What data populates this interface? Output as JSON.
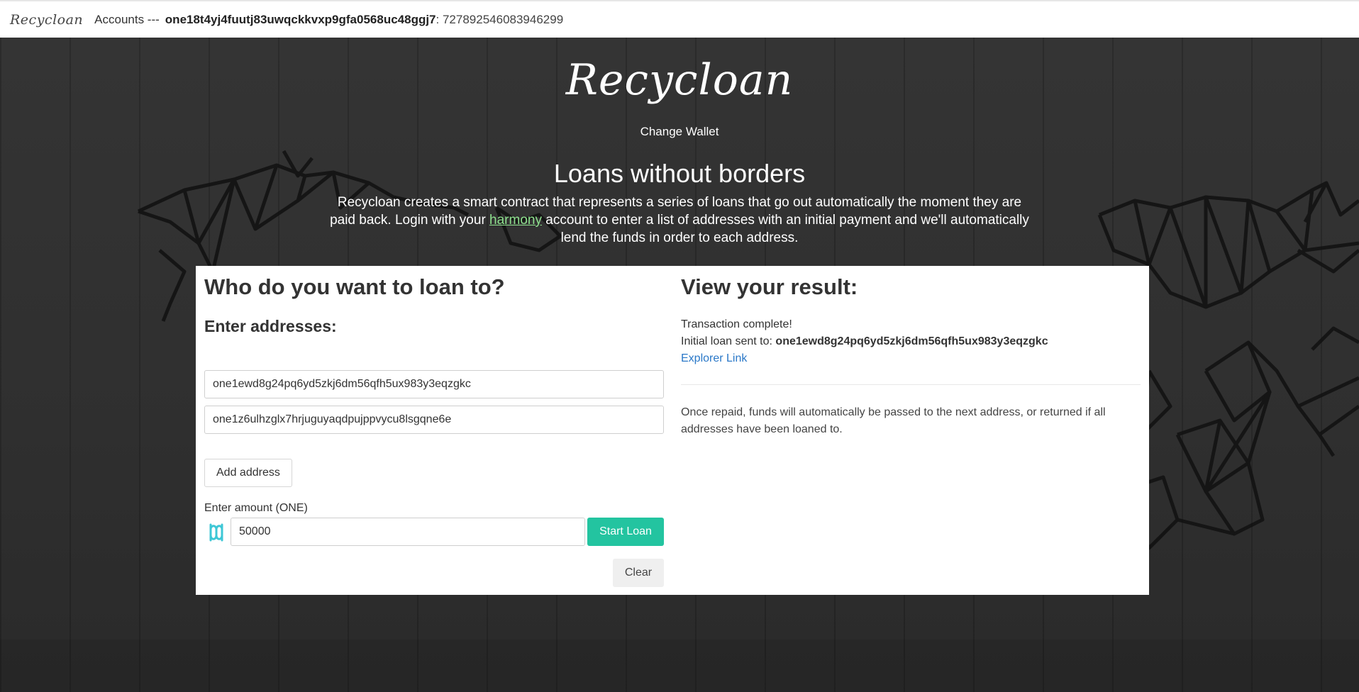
{
  "nav": {
    "logo": "Recycloan",
    "accounts_label": "Accounts ---",
    "address": "one18t4yj4fuutj83uwqckkvxp9gfa0568uc48ggj7",
    "balance": ": 727892546083946299"
  },
  "hero": {
    "brand": "Recycloan",
    "change_wallet": "Change Wallet",
    "headline": "Loans without borders",
    "intro_before": "Recycloan creates a smart contract that represents a series of loans that go out automatically the moment they are paid back. Login with your ",
    "intro_link": "harmony",
    "intro_after": " account to enter a list of addresses with an initial payment and we'll automatically lend the funds in order to each address."
  },
  "form": {
    "title": "Who do you want to loan to?",
    "subtitle": "Enter addresses:",
    "addresses": [
      "one1ewd8g24pq6yd5zkj6dm56qfh5ux983y3eqzgkc",
      "one1z6ulhzglx7hrjuguyaqdpujppvycu8lsgqne6e"
    ],
    "add_address_label": "Add address",
    "amount_label": "Enter amount (ONE)",
    "amount_value": "50000",
    "start_label": "Start Loan",
    "clear_label": "Clear"
  },
  "result": {
    "title": "View your result:",
    "status": "Transaction complete!",
    "sent_label": "Initial loan sent to: ",
    "sent_address": "one1ewd8g24pq6yd5zkj6dm56qfh5ux983y3eqzgkc",
    "explorer_link": "Explorer Link",
    "note": "Once repaid, funds will automatically be passed to the next address, or returned if all addresses have been loaned to."
  },
  "colors": {
    "accent": "#23c4a0",
    "link": "#2a78c8",
    "harmony_link": "#8ee08e"
  }
}
